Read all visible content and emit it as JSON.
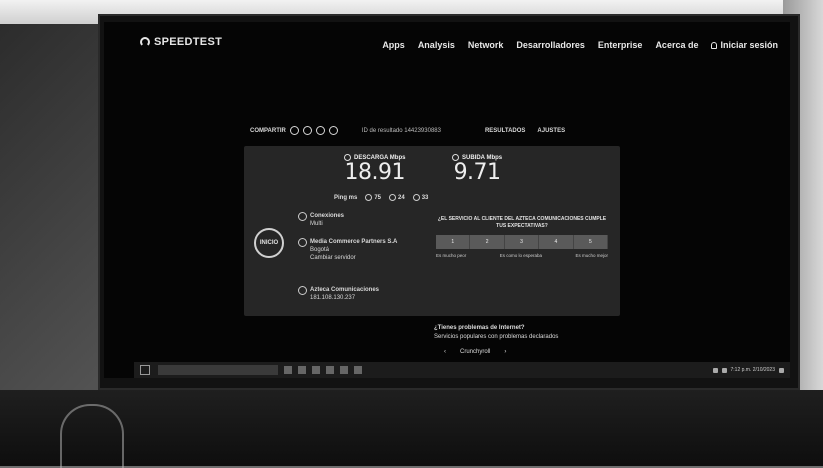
{
  "nav": {
    "logo": "SPEEDTEST",
    "links": [
      "Apps",
      "Analysis",
      "Network",
      "Desarrolladores",
      "Enterprise",
      "Acerca de"
    ],
    "login": "Iniciar sesión"
  },
  "share": {
    "label": "COMPARTIR",
    "result_id": "ID de resultado 14423930883",
    "results": "RESULTADOS",
    "settings": "AJUSTES"
  },
  "metrics": {
    "download_label": "DESCARGA Mbps",
    "download_value": "18.91",
    "upload_label": "SUBIDA Mbps",
    "upload_value": "9.71"
  },
  "ping": {
    "label": "Ping ms",
    "values": [
      "75",
      "24",
      "33"
    ]
  },
  "go_button": "INICIO",
  "connections": {
    "title": "Conexiones",
    "value": "Multi"
  },
  "isp": {
    "name": "Media Commerce Partners S.A",
    "city": "Bogotá",
    "action": "Cambiar servidor"
  },
  "server": {
    "name": "Azteca Comunicaciones",
    "ip": "181.108.130.237"
  },
  "survey": {
    "question": "¿EL SERVICIO AL CLIENTE DEL AZTECA COMUNICACIONES CUMPLE TUS EXPECTATIVAS?",
    "scale": [
      "1",
      "2",
      "3",
      "4",
      "5"
    ],
    "legend": [
      "Es mucho peor",
      "Es como lo esperaba",
      "Es mucho mejor"
    ]
  },
  "problems": {
    "title": "¿Tienes problemas de Internet?",
    "subtitle": "Servicios populares con problemas declarados",
    "dropdown": "Crunchyroll"
  },
  "taskbar": {
    "time": "7:12 p.m.",
    "date": "2/10/2023"
  }
}
